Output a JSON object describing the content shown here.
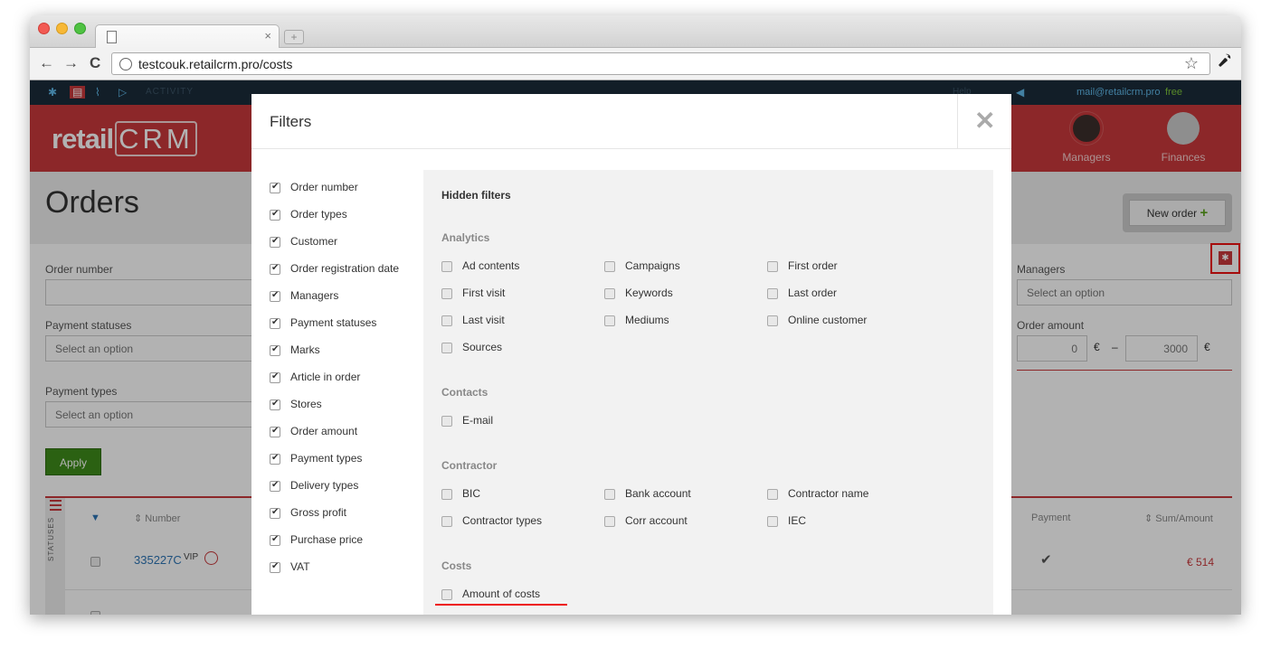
{
  "browser": {
    "url": "testcouk.retailcrm.pro/costs",
    "tab_close": "×",
    "newtab": "+",
    "back": "←",
    "forward": "→",
    "reload": "C",
    "star": "☆",
    "wrench": "🔧"
  },
  "topbar": {
    "activity": "ACTIVITY",
    "help": "Help",
    "email": "mail@retailcrm.pro",
    "plan": "free"
  },
  "header": {
    "logo_prefix": "retail",
    "logo_crm": "CRM",
    "managers": "Managers",
    "finances": "Finances"
  },
  "page": {
    "title": "Orders",
    "new_order": "New order",
    "new_order_plus": "+",
    "gear": "✱",
    "apply": "Apply"
  },
  "filters_bg": {
    "order_number": "Order number",
    "payment_statuses": "Payment statuses",
    "payment_types": "Payment types",
    "managers": "Managers",
    "order_amount": "Order amount",
    "select_option": "Select an option",
    "amount_from": "0",
    "amount_to": "3000",
    "currency": "€",
    "dash": "–"
  },
  "table": {
    "statuses": "STATUSES",
    "number_header": "⇕ Number",
    "payment_header": "Payment",
    "sum_header": "⇕ Sum/Amount",
    "row1_number": "335227C",
    "row1_vip": "VIP",
    "row1_sum": "€ 514"
  },
  "modal": {
    "title": "Filters",
    "close": "✕",
    "visible_filters": [
      "Order number",
      "Order types",
      "Customer",
      "Order registration date",
      "Managers",
      "Payment statuses",
      "Marks",
      "Article in order",
      "Stores",
      "Order amount",
      "Payment types",
      "Delivery types",
      "Gross profit",
      "Purchase price",
      "VAT"
    ],
    "hidden_title": "Hidden filters",
    "groups": {
      "analytics": {
        "title": "Analytics",
        "items": [
          "Ad contents",
          "Campaigns",
          "First order",
          "First visit",
          "Keywords",
          "Last order",
          "Last visit",
          "Mediums",
          "Online customer",
          "Sources"
        ]
      },
      "contacts": {
        "title": "Contacts",
        "items": [
          "E-mail"
        ]
      },
      "contractor": {
        "title": "Contractor",
        "items": [
          "BIC",
          "Bank account",
          "Contractor name",
          "Contractor types",
          "Corr account",
          "IEC"
        ]
      },
      "costs": {
        "title": "Costs",
        "items": [
          "Amount of costs"
        ]
      }
    }
  },
  "colors": {
    "brand_red": "#c9393b",
    "apply_green": "#3e8c1a",
    "link_blue": "#2d75b5",
    "highlight": "#ee1111"
  }
}
